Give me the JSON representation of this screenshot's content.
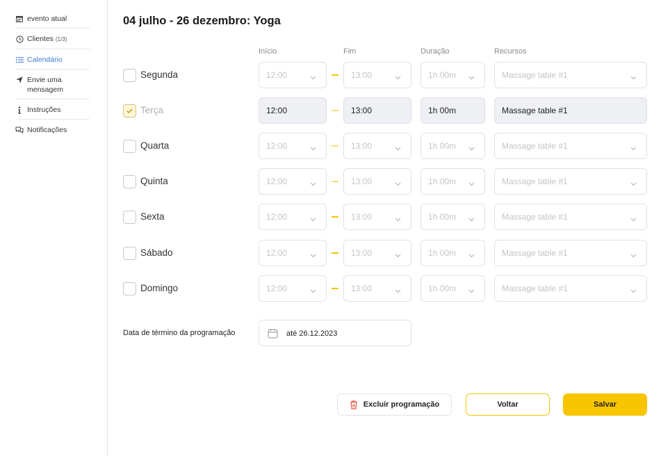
{
  "sidebar": {
    "items": [
      {
        "label": "evento atual",
        "icon": "calendar-icon",
        "extra": ""
      },
      {
        "label": "Clientes",
        "icon": "clock-icon",
        "extra": "(1/3)"
      },
      {
        "label": "Calendário",
        "icon": "list-icon",
        "extra": ""
      },
      {
        "label": "Envie uma mensagem",
        "icon": "send-icon",
        "extra": ""
      },
      {
        "label": "Instruções",
        "icon": "info-icon",
        "extra": ""
      },
      {
        "label": "Notificações",
        "icon": "chat-icon",
        "extra": ""
      }
    ],
    "active_color": "#3c7bd6"
  },
  "header": {
    "title": "04 julho - 26 dezembro: Yoga"
  },
  "columns": {
    "start": "Início",
    "end": "Fim",
    "duration": "Duração",
    "resources": "Recursos"
  },
  "days": [
    {
      "label": "Segunda",
      "checked": false,
      "start": "12:00",
      "end": "13:00",
      "duration": "1h 00m",
      "resource": "Massage table #1"
    },
    {
      "label": "Terça",
      "checked": true,
      "start": "12:00",
      "end": "13:00",
      "duration": "1h 00m",
      "resource": "Massage table #1"
    },
    {
      "label": "Quarta",
      "checked": false,
      "start": "12:00",
      "end": "13:00",
      "duration": "1h 00m",
      "resource": "Massage table #1"
    },
    {
      "label": "Quinta",
      "checked": false,
      "start": "12:00",
      "end": "13:00",
      "duration": "1h 00m",
      "resource": "Massage table #1"
    },
    {
      "label": "Sexta",
      "checked": false,
      "start": "12:00",
      "end": "13:00",
      "duration": "1h 00m",
      "resource": "Massage table #1"
    },
    {
      "label": "Sábado",
      "checked": false,
      "start": "12:00",
      "end": "13:00",
      "duration": "1h 00m",
      "resource": "Massage table #1"
    },
    {
      "label": "Domingo",
      "checked": false,
      "start": "12:00",
      "end": "13:00",
      "duration": "1h 00m",
      "resource": "Massage table #1"
    }
  ],
  "end_date": {
    "label": "Data de término da programação",
    "value": "até 26.12.2023"
  },
  "buttons": {
    "delete": "Excluir programação",
    "back": "Voltar",
    "save": "Salvar"
  },
  "colors": {
    "accent": "#f9c500",
    "delete_icon": "#e8543d"
  }
}
